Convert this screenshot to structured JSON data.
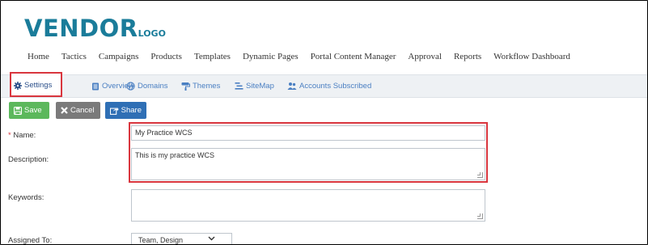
{
  "logo": {
    "main": "VENDOR",
    "small": "LOGO"
  },
  "topnav": [
    "Home",
    "Tactics",
    "Campaigns",
    "Products",
    "Templates",
    "Dynamic Pages",
    "Portal Content Manager",
    "Approval",
    "Reports",
    "Workflow Dashboard"
  ],
  "subnav": {
    "settings": "Settings",
    "overview": "Overview",
    "domains": "Domains",
    "themes": "Themes",
    "sitemap": "SiteMap",
    "accounts": "Accounts Subscribed"
  },
  "toolbar": {
    "save_label": "Save",
    "cancel_label": "Cancel",
    "share_label": "Share"
  },
  "form": {
    "name_required": "*",
    "name_label": "Name:",
    "name_value": "My Practice WCS",
    "description_label": "Description:",
    "description_value": "This is my practice WCS",
    "keywords_label": "Keywords:",
    "keywords_value": "",
    "assigned_label": "Assigned To:",
    "assigned_value": "Team, Design"
  },
  "colors": {
    "logo": "#1a7c9a",
    "link": "#4a7fc2",
    "save": "#5cb85c",
    "cancel": "#7a7a7a",
    "share": "#2f6fb5",
    "highlight": "#d9363e"
  }
}
